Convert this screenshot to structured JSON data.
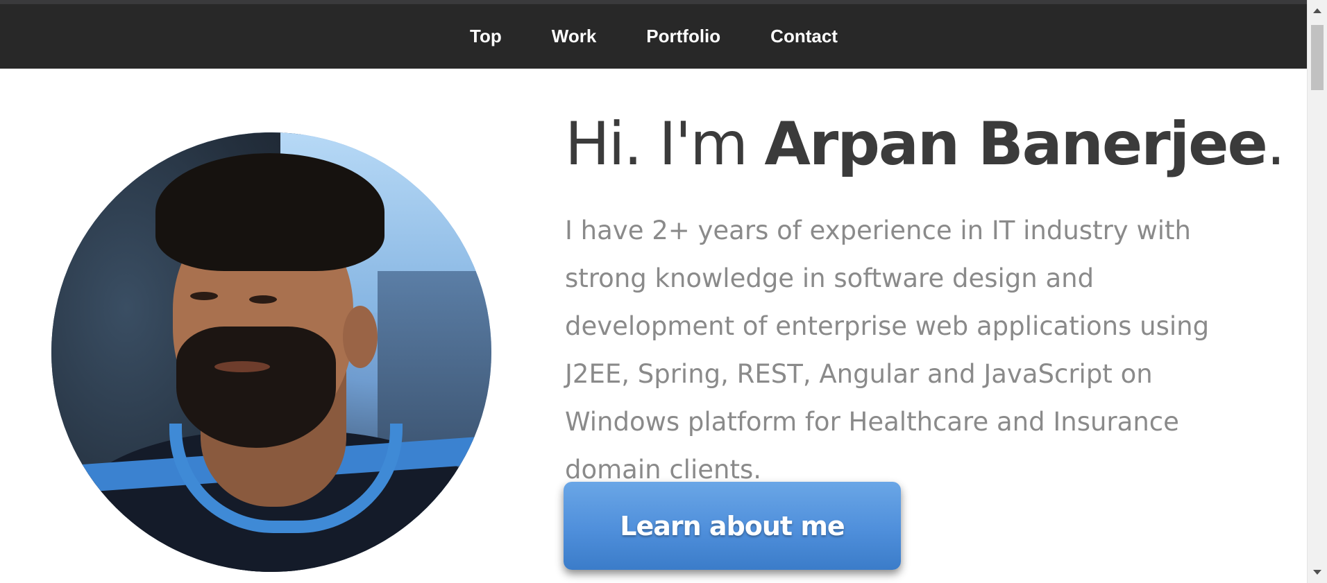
{
  "nav": {
    "items": [
      {
        "label": "Top"
      },
      {
        "label": "Work"
      },
      {
        "label": "Portfolio"
      },
      {
        "label": "Contact"
      }
    ]
  },
  "hero": {
    "greeting": "Hi. I'm ",
    "name": "Arpan Banerjee",
    "period": ".",
    "intro": "I have 2+ years of experience in IT industry with strong knowledge in software design and development of enterprise web applications using J2EE, Spring, REST, Angular and JavaScript on Windows platform for Healthcare and Insurance domain clients.",
    "cta_label": "Learn about me"
  },
  "colors": {
    "navbar_bg": "#282828",
    "cta_bg": "#4f8fdb",
    "headline_text": "#3b3b3b",
    "intro_text": "#8a8a8a"
  }
}
